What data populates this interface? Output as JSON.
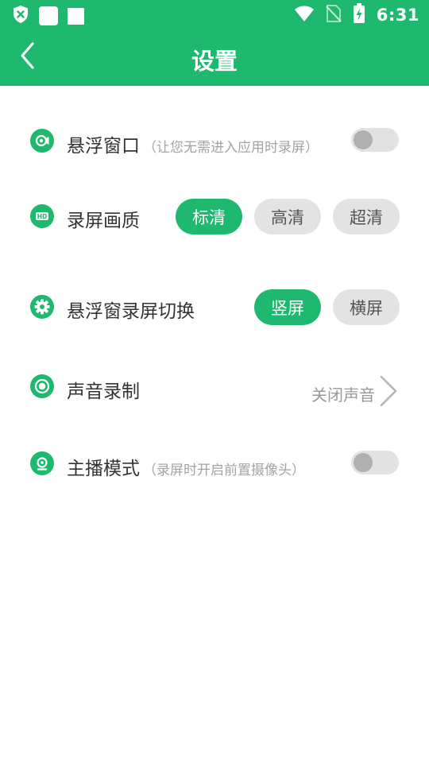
{
  "status_bar": {
    "time": "6:31",
    "icons": [
      "shield-icon",
      "app-notification-icon",
      "square-notification-icon",
      "wifi-icon",
      "no-sim-icon",
      "battery-charging-icon"
    ]
  },
  "app_bar": {
    "title": "设置",
    "back_icon": "back-chevron-icon"
  },
  "colors": {
    "accent": "#1eb86e",
    "pill_inactive": "#e3e3e3",
    "toggle_off": "#e2e2e2"
  },
  "settings": {
    "floating_window": {
      "label": "悬浮窗口",
      "hint": "（让您无需进入应用时录屏）",
      "enabled": false,
      "icon": "record-camera-icon"
    },
    "quality": {
      "label": "录屏画质",
      "icon": "hd-icon",
      "options": [
        "标清",
        "高清",
        "超清"
      ],
      "selected": "标清"
    },
    "orientation": {
      "label": "悬浮窗录屏切换",
      "icon": "gear-icon",
      "options": [
        "竖屏",
        "横屏"
      ],
      "selected": "竖屏"
    },
    "audio": {
      "label": "声音录制",
      "icon": "record-dot-icon",
      "value": "关闭声音"
    },
    "anchor_mode": {
      "label": "主播模式",
      "hint": "（录屏时开启前置摄像头）",
      "enabled": false,
      "icon": "webcam-icon"
    }
  }
}
